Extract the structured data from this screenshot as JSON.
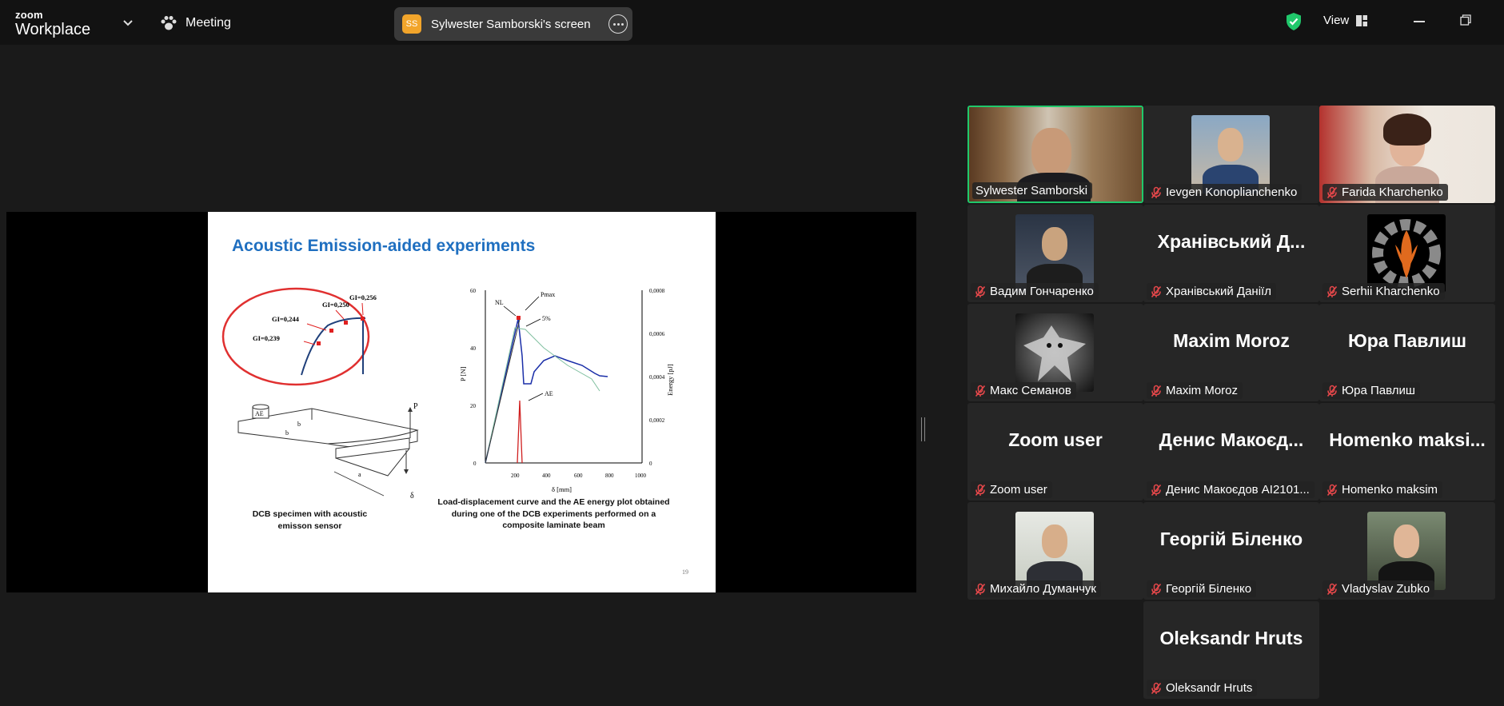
{
  "app": {
    "brand_top": "zoom",
    "brand_bottom": "Workplace"
  },
  "toolbar": {
    "meeting_label": "Meeting",
    "share_badge": "SS",
    "share_label": "Sylwester Samborski's screen",
    "view_label": "View"
  },
  "slide": {
    "title": "Acoustic Emission-aided experiments",
    "caption_left": "DCB specimen with acoustic emisson sensor",
    "caption_right": "Load-displacement curve and the AE energy plot obtained during one of the DCB experiments performed on a composite laminate beam",
    "page": "19",
    "labels": {
      "g1": "GI=0,239",
      "g2": "GI=0,244",
      "g3": "GI=0,250",
      "g4": "GI=0,256",
      "ae": "AE",
      "p": "P",
      "delta": "δ",
      "a": "a",
      "b": "b",
      "b2": "b",
      "nl": "NL",
      "pmax": "Pmax",
      "five": "5%",
      "ae_curve": "AE",
      "xlabel": "δ [mm]",
      "ylabel": "P [N]",
      "y2label": "Energy [pJ]"
    },
    "ticks_x": [
      "200",
      "400",
      "600",
      "800",
      "1000"
    ],
    "ticks_y": [
      "0",
      "20",
      "40",
      "60"
    ],
    "ticks_y2": [
      "0",
      "0,0002",
      "0,0004",
      "0,0006",
      "0,0008"
    ]
  },
  "participants": [
    {
      "name": "Sylwester Samborski",
      "muted": false,
      "display": "video",
      "speaking": true
    },
    {
      "name": "Ievgen Konoplianchenko",
      "muted": true,
      "display": "photo"
    },
    {
      "name": "Farida Kharchenko",
      "muted": true,
      "display": "video"
    },
    {
      "name": "Вадим Гончаренко",
      "muted": true,
      "display": "photo"
    },
    {
      "name": "Хранівський Даніїл",
      "muted": true,
      "display": "text",
      "big": "Хранівський Д..."
    },
    {
      "name": "Serhii Kharchenko",
      "muted": true,
      "display": "photo"
    },
    {
      "name": "Макс Семанов",
      "muted": true,
      "display": "photo"
    },
    {
      "name": "Maxim Moroz",
      "muted": true,
      "display": "text",
      "big": "Maxim Moroz"
    },
    {
      "name": "Юра Павлиш",
      "muted": true,
      "display": "text",
      "big": "Юра Павлиш"
    },
    {
      "name": "Zoom user",
      "muted": true,
      "display": "text",
      "big": "Zoom user"
    },
    {
      "name": "Денис Макоєдов AI2101...",
      "muted": true,
      "display": "text",
      "big": "Денис Макоєд..."
    },
    {
      "name": "Homenko maksim",
      "muted": true,
      "display": "text",
      "big": "Homenko maksi..."
    },
    {
      "name": "Михайло Думанчук",
      "muted": true,
      "display": "photo"
    },
    {
      "name": "Георгій Біленко",
      "muted": true,
      "display": "text",
      "big": "Георгій Біленко"
    },
    {
      "name": "Vladyslav Zubko",
      "muted": true,
      "display": "photo"
    },
    {
      "name": "Oleksandr Hruts",
      "muted": true,
      "display": "text",
      "big": "Oleksandr Hruts"
    }
  ],
  "colors": {
    "speaking_border": "#20c86b",
    "shield": "#20c86b",
    "muted_mic": "#e8484b",
    "slide_title": "#1f6fc0",
    "share_badge": "#f2a52b"
  }
}
